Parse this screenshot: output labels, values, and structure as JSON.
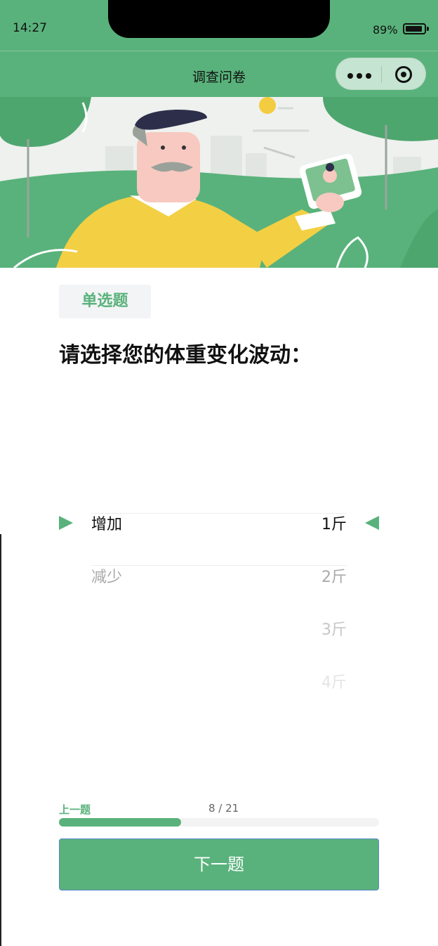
{
  "status_bar": {
    "time": "14:27",
    "battery_percent": "89%",
    "battery_level": 0.89
  },
  "nav": {
    "title": "调查问卷",
    "menu_icon": "more-dots-icon",
    "close_icon": "target-close-icon"
  },
  "banner": {
    "description_icon": "survey-banner-illustration"
  },
  "question": {
    "type_tag": "单选题",
    "text": "请选择您的体重变化波动："
  },
  "picker": {
    "left_options": [
      {
        "label": "增加",
        "selected": true
      },
      {
        "label": "减少",
        "selected": false
      }
    ],
    "right_options": [
      {
        "label": "1斤",
        "selected": true
      },
      {
        "label": "2斤",
        "selected": false
      },
      {
        "label": "3斤",
        "selected": false
      },
      {
        "label": "4斤",
        "selected": false
      }
    ]
  },
  "progress": {
    "prev_label": "上一题",
    "current": 8,
    "total": 21,
    "counter_text": "8 / 21"
  },
  "footer": {
    "next_label": "下一题"
  },
  "colors": {
    "accent": "#59b27b",
    "text": "#111111",
    "muted": "#999999"
  }
}
